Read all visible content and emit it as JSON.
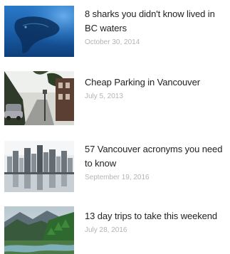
{
  "articles": [
    {
      "title": "8 sharks you didn't know lived in BC waters",
      "date": "October 30, 2014",
      "thumbnail_icon": "shark-underwater-photo"
    },
    {
      "title": "Cheap Parking in Vancouver",
      "date": "July 5, 2013",
      "thumbnail_icon": "street-parking-photo"
    },
    {
      "title": "57 Vancouver acronyms you need to know",
      "date": "September 19, 2016",
      "thumbnail_icon": "city-skyline-photo"
    },
    {
      "title": "13 day trips to take this weekend",
      "date": "July 28, 2016",
      "thumbnail_icon": "mountain-valley-photo"
    }
  ],
  "colors": {
    "title_text": "#222222",
    "date_text": "#b4b4b4",
    "background": "#ffffff"
  }
}
